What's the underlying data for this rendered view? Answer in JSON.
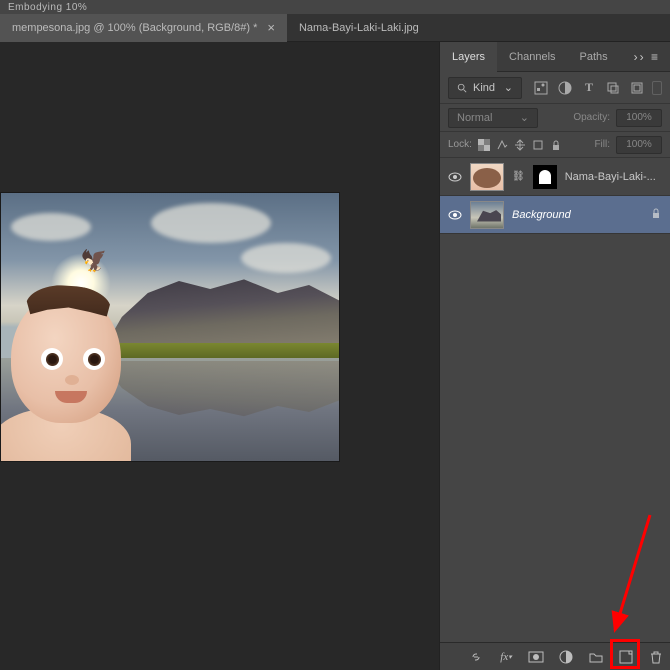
{
  "topbar": {
    "label": "Embodying   10%"
  },
  "tabs": [
    {
      "label": "mempesona.jpg @ 100% (Background, RGB/8#) *",
      "active": true
    },
    {
      "label": "Nama-Bayi-Laki-Laki.jpg",
      "active": false
    }
  ],
  "panel": {
    "tabs": {
      "layers": "Layers",
      "channels": "Channels",
      "paths": "Paths"
    },
    "filter": {
      "kind": "Kind"
    },
    "blend": {
      "mode": "Normal",
      "opacity_label": "Opacity:",
      "opacity": "100%"
    },
    "lock": {
      "label": "Lock:",
      "fill_label": "Fill:",
      "fill": "100%"
    },
    "layers": [
      {
        "name": "Nama-Bayi-Laki-...",
        "selected": false,
        "locked": false
      },
      {
        "name": "Background",
        "selected": true,
        "locked": true
      }
    ]
  }
}
